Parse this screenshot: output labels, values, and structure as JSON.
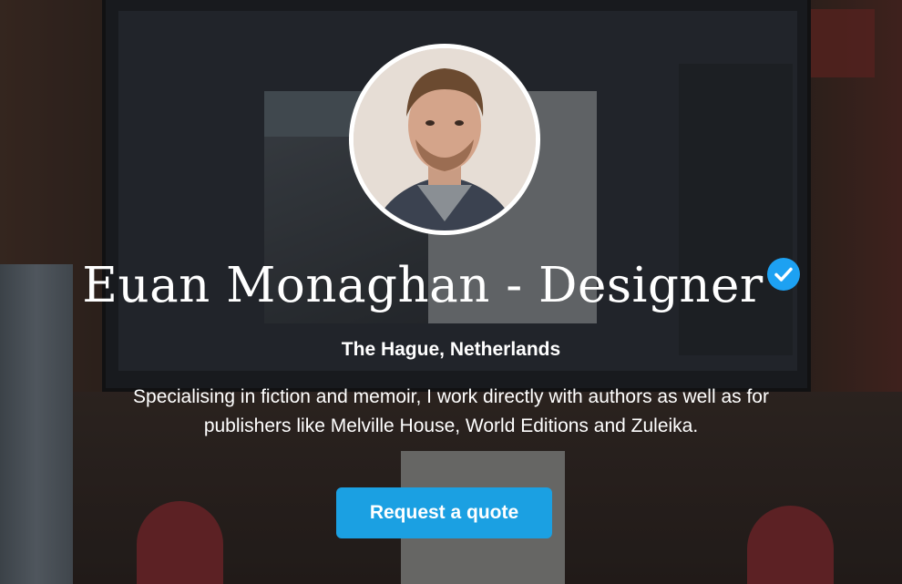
{
  "profile": {
    "name": "Euan Monaghan - Designer",
    "location": "The Hague, Netherlands",
    "tagline_line1": "Specialising in fiction and memoir, I work directly with authors as well as for",
    "tagline_line2": "publishers like Melville House, World Editions and Zuleika.",
    "verified_icon": "check-badge-icon"
  },
  "cta": {
    "label": "Request a quote"
  },
  "colors": {
    "accent": "#1ba0e2",
    "verified": "#1da1f2",
    "text": "#ffffff"
  }
}
